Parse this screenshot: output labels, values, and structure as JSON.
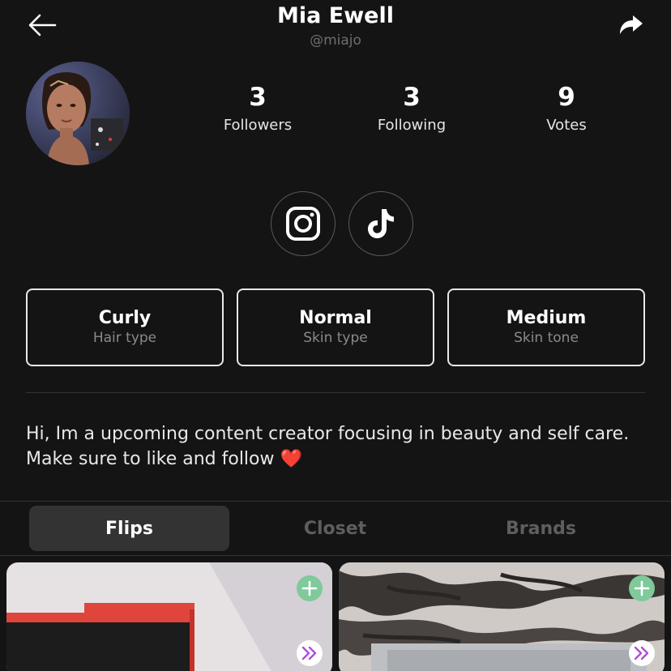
{
  "header": {
    "title": "Mia Ewell",
    "handle": "@miajo",
    "back_icon": "back-arrow-icon",
    "share_icon": "share-arrow-icon"
  },
  "stats": [
    {
      "value": "3",
      "label": "Followers"
    },
    {
      "value": "3",
      "label": "Following"
    },
    {
      "value": "9",
      "label": "Votes"
    }
  ],
  "social": [
    {
      "icon": "instagram-icon"
    },
    {
      "icon": "tiktok-icon"
    }
  ],
  "attributes": [
    {
      "value": "Curly",
      "label": "Hair type"
    },
    {
      "value": "Normal",
      "label": "Skin type"
    },
    {
      "value": "Medium",
      "label": "Skin tone"
    }
  ],
  "bio": {
    "text": "Hi, Im a upcoming content creator focusing in beauty and self care. Make sure to like and follow",
    "emoji": "❤️"
  },
  "tabs": [
    {
      "label": "Flips",
      "active": true
    },
    {
      "label": "Closet",
      "active": false
    },
    {
      "label": "Brands",
      "active": false
    }
  ],
  "colors": {
    "background": "#141414",
    "active_tab": "#333333",
    "add_button": "#7fc99a",
    "next_icon": "#b04fd6"
  }
}
